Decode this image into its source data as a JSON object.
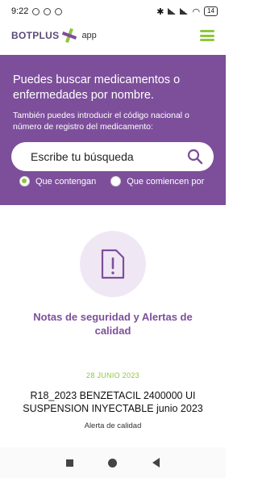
{
  "status_bar": {
    "time": "9:22",
    "battery": "14"
  },
  "header": {
    "logo_text": "BOTPLUS",
    "logo_app": "app"
  },
  "hero": {
    "title": "Puedes buscar medicamentos o enfermedades por nombre.",
    "subtitle": "También puedes introducir el código nacional o número de registro del medicamento:",
    "search_placeholder": "Escribe tu búsqueda",
    "radio_contain": "Que contengan",
    "radio_start": "Que comiencen por",
    "selected_option": "Que contengan"
  },
  "section": {
    "title": "Notas de seguridad y Alertas de calidad"
  },
  "news": {
    "date": "28 JUNIO 2023",
    "title": "R18_2023 BENZETACIL 2400000 UI SUSPENSION INYECTABLE junio 2023",
    "tag": "Alerta de calidad"
  },
  "colors": {
    "primary": "#7d4f9b",
    "accent": "#8dc63f",
    "icon_bg": "#f0e7f4"
  }
}
